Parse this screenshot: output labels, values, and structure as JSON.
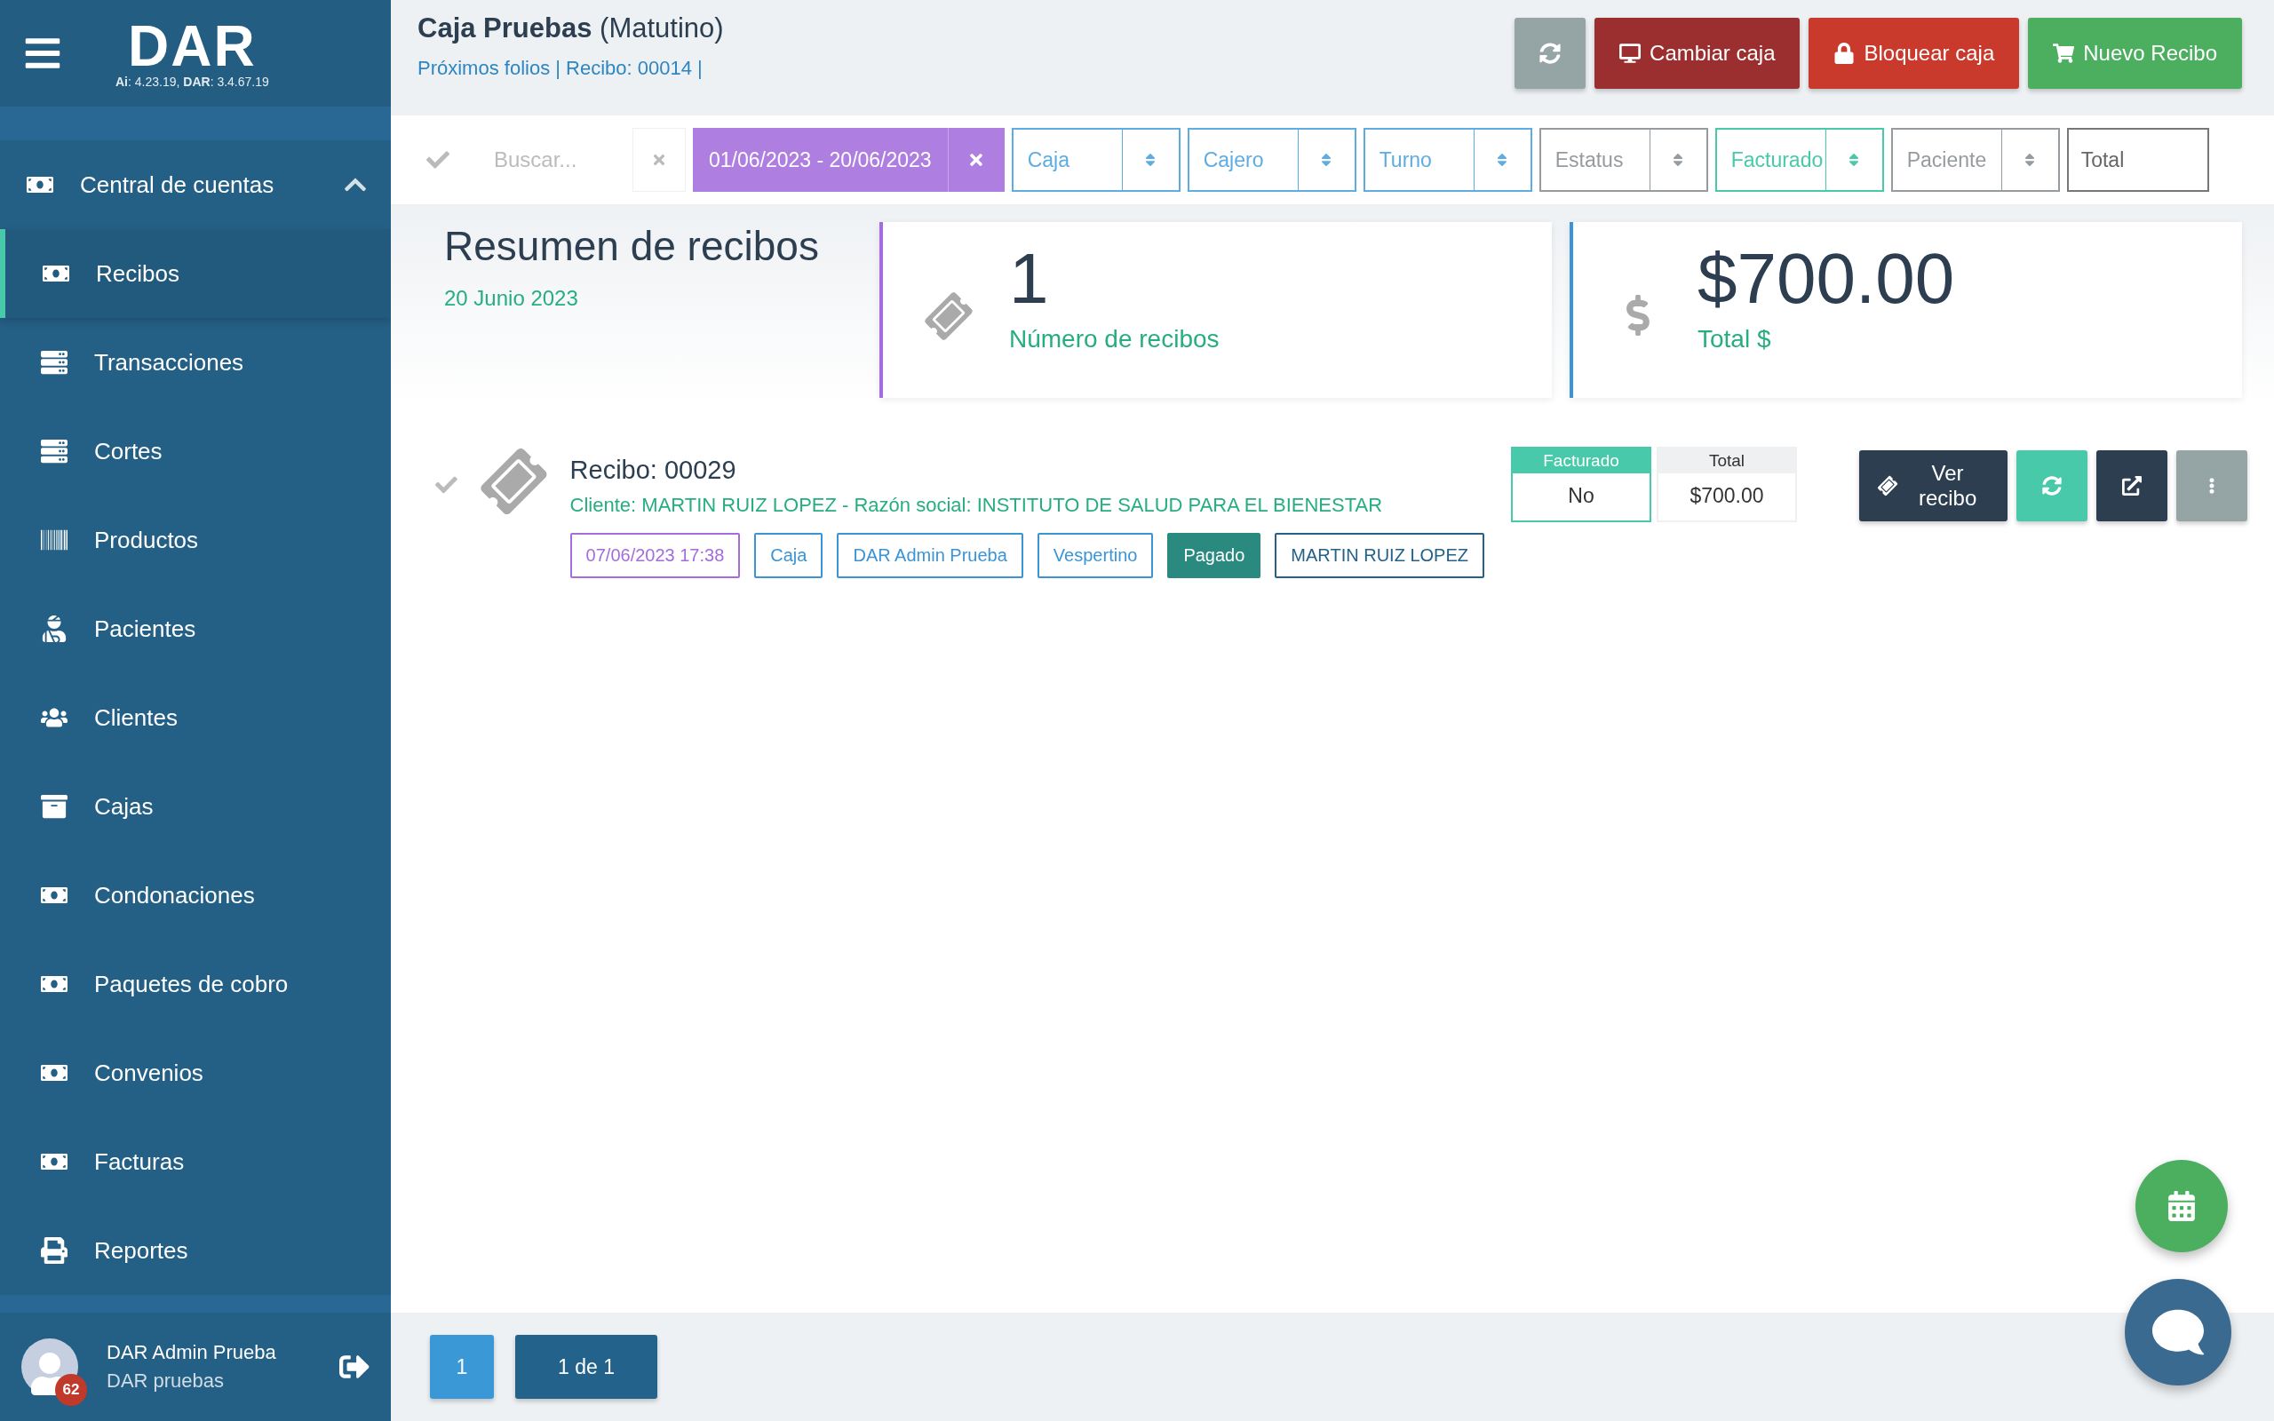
{
  "sidebar": {
    "logo": "DAR",
    "version": "**Ai**: 4.23.19, **DAR**: 3.4.67.19",
    "menu": [
      {
        "label": "Central de cuentas",
        "expanded": true,
        "children": [
          {
            "label": "Recibos",
            "selected": true
          },
          {
            "label": "Transacciones",
            "selected": false
          },
          {
            "label": "Cortes",
            "selected": false
          },
          {
            "label": "Productos",
            "selected": false
          },
          {
            "label": "Pacientes",
            "selected": false
          },
          {
            "label": "Clientes",
            "selected": false
          },
          {
            "label": "Cajas",
            "selected": false
          },
          {
            "label": "Condonaciones",
            "selected": false
          },
          {
            "label": "Paquetes de cobro",
            "selected": false
          },
          {
            "label": "Convenios",
            "selected": false
          },
          {
            "label": "Facturas",
            "selected": false
          },
          {
            "label": "Reportes",
            "selected": false
          }
        ]
      }
    ],
    "user": {
      "name": "DAR Admin Prueba",
      "role": "DAR pruebas",
      "badge": "62"
    }
  },
  "header": {
    "title": "Caja Pruebas",
    "shift": "(Matutino)",
    "subtitle": "Próximos folios | Recibo: 00014 |",
    "buttons": [
      {
        "kind": "refresh"
      },
      {
        "kind": "change",
        "label": "Cambiar caja"
      },
      {
        "kind": "lock",
        "label": "Bloquear caja"
      },
      {
        "kind": "new",
        "label": "Nuevo Recibo"
      }
    ]
  },
  "filters": {
    "search": {
      "placeholder": "Buscar..."
    },
    "date_range": "01/06/2023 - 20/06/2023",
    "selects": [
      {
        "label": "Caja",
        "color": "#5dade2"
      },
      {
        "label": "Cajero",
        "color": "#5dade2"
      },
      {
        "label": "Turno",
        "color": "#5dade2"
      },
      {
        "label": "Estatus",
        "color": "#959b9f"
      },
      {
        "label": "Facturado",
        "color": "#48c9a9"
      },
      {
        "label": "Paciente",
        "color": "#959b9f"
      }
    ],
    "total": {
      "placeholder": "Total"
    }
  },
  "summary": {
    "title": "Resumen de recibos",
    "date": "20 Junio 2023",
    "cards": [
      {
        "kind": "count",
        "value": "1",
        "label": "Número de recibos",
        "color": "#a66bdc"
      },
      {
        "kind": "total",
        "value": "$700.00",
        "label": "Total $",
        "color": "#3a94d6"
      }
    ]
  },
  "receipts": [
    {
      "title": "Recibo: 00029",
      "client": "Cliente: MARTIN RUIZ LOPEZ - Razón social: INSTITUTO DE SALUD PARA EL BIENESTAR",
      "invoiced_label": "Facturado",
      "invoiced": "No",
      "total_label": "Total",
      "total": "$700.00",
      "view_label": "Ver recibo",
      "tags": [
        {
          "label": "07/06/2023 17:38",
          "kind": "outline",
          "color": "#a66bdc"
        },
        {
          "label": "Caja",
          "kind": "outline",
          "color": "#3a94d6"
        },
        {
          "label": "DAR Admin Prueba",
          "kind": "outline",
          "color": "#3a94d6"
        },
        {
          "label": "Vespertino",
          "kind": "outline",
          "color": "#3a94d6"
        },
        {
          "label": "Pagado",
          "kind": "filled",
          "color": "#2a8a80"
        },
        {
          "label": "MARTIN RUIZ LOPEZ",
          "kind": "outline",
          "color": "#23628a"
        }
      ]
    }
  ],
  "pagination": {
    "pages": [
      {
        "label": "1",
        "selected": true
      }
    ],
    "summary": "1 de 1"
  }
}
